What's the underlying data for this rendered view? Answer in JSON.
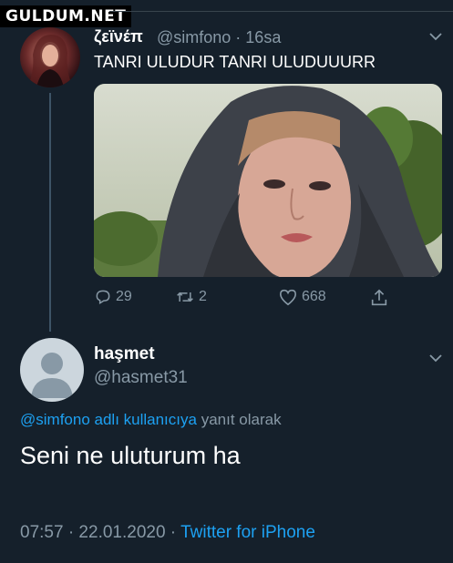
{
  "watermark": "GULDUM.NET",
  "tweet1": {
    "display_name": "ζεϊνέπ",
    "handle_time": "@simfono · 16sa",
    "text": "TANRI ULUDUR TANRI ULUDUUURR",
    "actions": {
      "replies": "29",
      "retweets": "2",
      "likes": "668"
    }
  },
  "reply": {
    "display_name": "haşmet",
    "handle": "@hasmet31",
    "reply_context_link": "@simfono adlı kullanıcıya",
    "reply_context_suffix": " yanıt olarak",
    "text": "Seni ne uluturum ha",
    "timestamp": "07:57 · 22.01.2020 · ",
    "source": "Twitter for iPhone"
  },
  "icons": [
    "reply-icon",
    "retweet-icon",
    "like-icon",
    "share-icon",
    "chevron-down-icon",
    "default-avatar-icon"
  ],
  "colors": {
    "background": "#15202b",
    "secondary_text": "#8899a6",
    "link": "#1da1f2",
    "thread_line": "#3d5466"
  }
}
